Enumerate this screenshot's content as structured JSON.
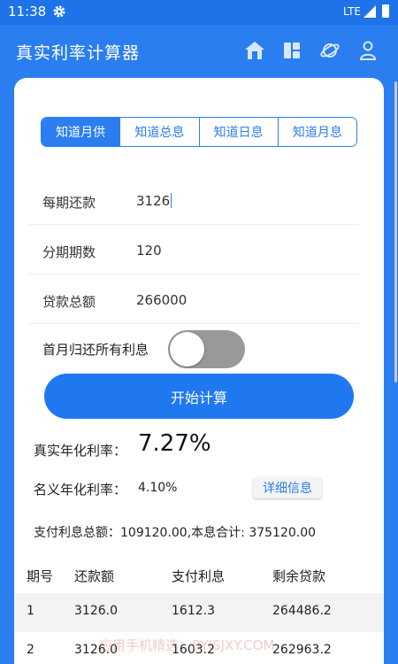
{
  "status": {
    "time": "11:38",
    "network": "LTE"
  },
  "app": {
    "title": "真实利率计算器"
  },
  "tabs": [
    {
      "label": "知道月供"
    },
    {
      "label": "知道总息"
    },
    {
      "label": "知道日息"
    },
    {
      "label": "知道月息"
    }
  ],
  "form": {
    "payment": {
      "label": "每期还款",
      "value": "3126"
    },
    "periods": {
      "label": "分期期数",
      "value": "120"
    },
    "principal": {
      "label": "贷款总额",
      "value": "266000"
    },
    "first_month": {
      "label": "首月归还所有利息",
      "checked": false
    }
  },
  "start_button": "开始计算",
  "results": {
    "real_label": "真实年化利率：",
    "real_value": "7.27%",
    "nominal_label": "名义年化利率：",
    "nominal_value": "4.10%",
    "detail_button": "详细信息",
    "summary": "支付利息总额：109120.00,本息合计: 375120.00"
  },
  "table": {
    "headers": [
      "期号",
      "还款额",
      "支付利息",
      "剩余贷款"
    ],
    "rows": [
      [
        "1",
        "3126.0",
        "1612.3",
        "264486.2"
      ],
      [
        "2",
        "3126.0",
        "1603.2",
        "262963.2"
      ]
    ]
  },
  "watermark": "应用手机精选：BYJSJXY.COM",
  "colors": {
    "primary": "#2a7ef0",
    "status_bar": "#1e73e8",
    "toggle_off": "#999999"
  },
  "icons": [
    "gear-icon",
    "signal-icon",
    "battery-icon",
    "home-icon",
    "dashboard-icon",
    "planet-icon",
    "user-icon"
  ]
}
